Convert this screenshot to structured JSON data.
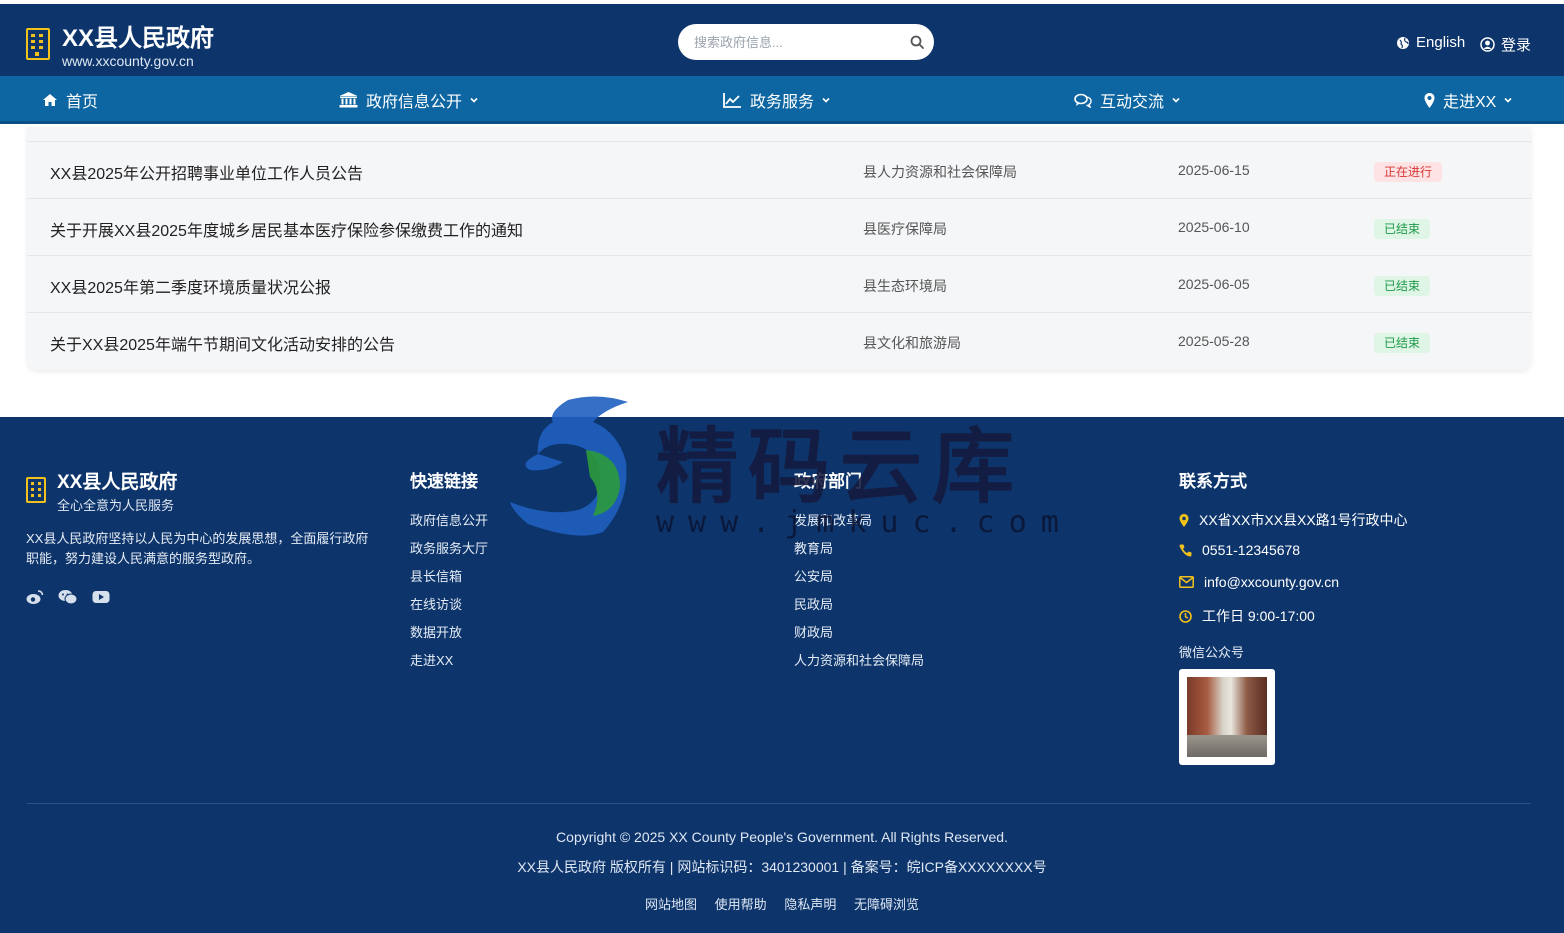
{
  "header": {
    "title": "XX县人民政府",
    "domain": "www.xxcounty.gov.cn",
    "search_placeholder": "搜索政府信息...",
    "language_label": "English",
    "login_label": "登录"
  },
  "nav": {
    "items": [
      {
        "label": "首页",
        "icon": "home-icon",
        "has_dropdown": false
      },
      {
        "label": "政府信息公开",
        "icon": "institution-icon",
        "has_dropdown": true
      },
      {
        "label": "政务服务",
        "icon": "line-chart-icon",
        "has_dropdown": true
      },
      {
        "label": "互动交流",
        "icon": "comments-icon",
        "has_dropdown": true
      },
      {
        "label": "走进XX",
        "icon": "map-marker-icon",
        "has_dropdown": true
      }
    ]
  },
  "notices": [
    {
      "title": "XX县2025年公开招聘事业单位工作人员公告",
      "dept": "县人力资源和社会保障局",
      "date": "2025-06-15",
      "status": "正在进行",
      "status_type": "active"
    },
    {
      "title": "关于开展XX县2025年度城乡居民基本医疗保险参保缴费工作的通知",
      "dept": "县医疗保障局",
      "date": "2025-06-10",
      "status": "已结束",
      "status_type": "ended"
    },
    {
      "title": "XX县2025年第二季度环境质量状况公报",
      "dept": "县生态环境局",
      "date": "2025-06-05",
      "status": "已结束",
      "status_type": "ended"
    },
    {
      "title": "关于XX县2025年端午节期间文化活动安排的公告",
      "dept": "县文化和旅游局",
      "date": "2025-05-28",
      "status": "已结束",
      "status_type": "ended"
    }
  ],
  "footer": {
    "name": "XX县人民政府",
    "slogan": "全心全意为人民服务",
    "description": "XX县人民政府坚持以人民为中心的发展思想，全面履行政府职能，努力建设人民满意的服务型政府。",
    "social_icons": [
      "weibo-icon",
      "wechat-icon",
      "youtube-icon"
    ],
    "quick_links": {
      "title": "快速链接",
      "items": [
        "政府信息公开",
        "政务服务大厅",
        "县长信箱",
        "在线访谈",
        "数据开放",
        "走进XX"
      ]
    },
    "departments": {
      "title": "政府部门",
      "items": [
        "发展和改革局",
        "教育局",
        "公安局",
        "民政局",
        "财政局",
        "人力资源和社会保障局"
      ]
    },
    "contact": {
      "title": "联系方式",
      "address": "XX省XX市XX县XX路1号行政中心",
      "phone": "0551-12345678",
      "email": "info@xxcounty.gov.cn",
      "hours": "工作日 9:00-17:00",
      "wechat_label": "微信公众号"
    },
    "copyright": "Copyright © 2025 XX County People's Government. All Rights Reserved.",
    "icp": "XX县人民政府 版权所有 | 网站标识码：3401230001 | 备案号：皖ICP备XXXXXXXX号",
    "bottom_links": [
      "网站地图",
      "使用帮助",
      "隐私声明",
      "无障碍浏览"
    ]
  },
  "watermark": {
    "text": "精码云库",
    "url": "www.jmkuc.com"
  },
  "colors": {
    "header_bg": "#0d356b",
    "nav_bg": "#0d66a1",
    "accent": "#f2c21c",
    "status_active": "#d93636",
    "status_ended": "#1e9a4a"
  }
}
